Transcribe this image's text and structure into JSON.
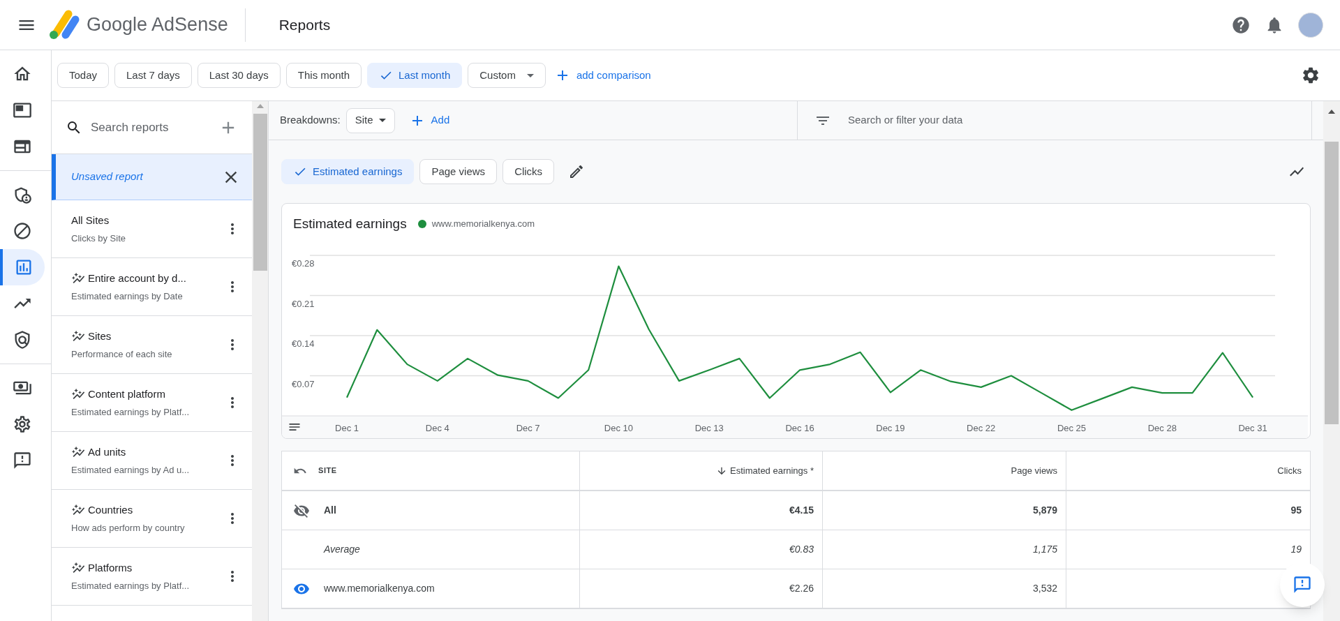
{
  "app": {
    "product": "Google AdSense",
    "page_title": "Reports"
  },
  "nav": [
    {
      "selected": false
    },
    {
      "selected": false
    },
    {
      "selected": false
    },
    {
      "selected": false
    },
    {
      "selected": false
    },
    {
      "selected": true
    },
    {
      "selected": false
    },
    {
      "selected": false
    },
    {
      "selected": false
    },
    {
      "selected": false
    },
    {
      "selected": false
    }
  ],
  "date_ranges": [
    {
      "label": "Today",
      "selected": false,
      "kind": "chip"
    },
    {
      "label": "Last 7 days",
      "selected": false,
      "kind": "chip"
    },
    {
      "label": "Last 30 days",
      "selected": false,
      "kind": "chip"
    },
    {
      "label": "This month",
      "selected": false,
      "kind": "chip"
    },
    {
      "label": "Last month",
      "selected": true,
      "kind": "chip"
    },
    {
      "label": "Custom",
      "selected": false,
      "kind": "dropdown"
    }
  ],
  "add_comparison": "add comparison",
  "reports": {
    "search_placeholder": "Search reports",
    "items": [
      {
        "title": "Unsaved report",
        "kind": "unsaved",
        "selected": true
      },
      {
        "title": "All Sites",
        "subtitle": "Clicks by Site",
        "kind": "saved",
        "selected": false
      },
      {
        "title": "Entire account by d...",
        "subtitle": "Estimated earnings by Date",
        "kind": "suggested",
        "selected": false
      },
      {
        "title": "Sites",
        "subtitle": "Performance of each site",
        "kind": "suggested",
        "selected": false
      },
      {
        "title": "Content platform",
        "subtitle": "Estimated earnings by Platf...",
        "kind": "suggested",
        "selected": false
      },
      {
        "title": "Ad units",
        "subtitle": "Estimated earnings by Ad u...",
        "kind": "suggested",
        "selected": false
      },
      {
        "title": "Countries",
        "subtitle": "How ads perform by country",
        "kind": "suggested",
        "selected": false
      },
      {
        "title": "Platforms",
        "subtitle": "Estimated earnings by Platf...",
        "kind": "suggested",
        "selected": false
      }
    ]
  },
  "breakdowns": {
    "label": "Breakdowns:",
    "value": "Site",
    "add": "Add",
    "filter_placeholder": "Search or filter your data"
  },
  "metrics": [
    {
      "label": "Estimated earnings",
      "selected": true
    },
    {
      "label": "Page views",
      "selected": false
    },
    {
      "label": "Clicks",
      "selected": false
    }
  ],
  "chart": {
    "chart_data": {
      "type": "line",
      "title": "Estimated earnings",
      "categories": [
        "Dec 1",
        null,
        null,
        "Dec 4",
        null,
        null,
        "Dec 7",
        null,
        null,
        "Dec 10",
        null,
        null,
        "Dec 13",
        null,
        null,
        "Dec 16",
        null,
        null,
        "Dec 19",
        null,
        null,
        "Dec 22",
        null,
        null,
        "Dec 25",
        null,
        null,
        "Dec 28",
        null,
        null,
        "Dec 31"
      ],
      "ylim": [
        0,
        0.28
      ],
      "grid": true,
      "yticks": [
        {
          "value": 0.07,
          "label": "€0.07"
        },
        {
          "value": 0.14,
          "label": "€0.14"
        },
        {
          "value": 0.21,
          "label": "€0.21"
        },
        {
          "value": 0.28,
          "label": "€0.28"
        }
      ],
      "series": [
        {
          "name": "www.memorialkenya.com",
          "color": "#1e8e3e",
          "values": [
            0.032,
            0.15,
            0.09,
            0.061,
            0.1,
            0.071,
            0.061,
            0.031,
            0.08,
            0.261,
            0.151,
            0.061,
            0.08,
            0.1,
            0.031,
            0.08,
            0.09,
            0.111,
            0.041,
            0.08,
            0.06,
            0.05,
            0.07,
            0.04,
            0.01,
            0.03,
            0.05,
            0.04,
            0.04,
            0.11,
            0.032
          ]
        }
      ]
    }
  },
  "table": {
    "columns": [
      {
        "label": "SITE",
        "sorted": false
      },
      {
        "label": "Estimated earnings *",
        "sorted": true
      },
      {
        "label": "Page views",
        "sorted": false
      },
      {
        "label": "Clicks",
        "sorted": false
      }
    ],
    "rows": [
      {
        "kind": "total",
        "visible": false,
        "cells": [
          "All",
          "€4.15",
          "5,879",
          "95"
        ]
      },
      {
        "kind": "average",
        "cells": [
          "Average",
          "€0.83",
          "1,175",
          "19"
        ]
      },
      {
        "kind": "site",
        "visible": true,
        "cells": [
          "www.memorialkenya.com",
          "€2.26",
          "3,532"
        ]
      }
    ]
  }
}
